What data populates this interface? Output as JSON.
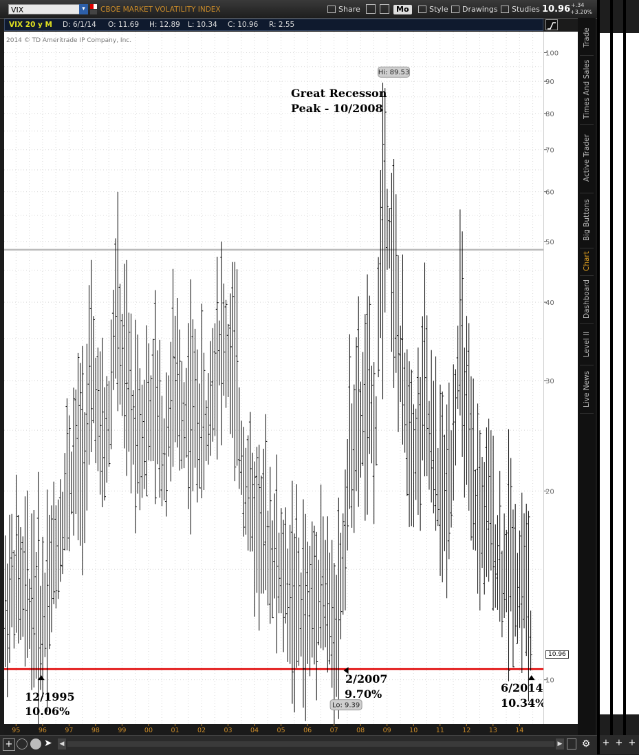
{
  "toolbar": {
    "symbol": "VIX",
    "description": "CBOE MARKET VOLATILITY INDEX",
    "share": "Share",
    "mode": "Mo",
    "style": "Style",
    "drawings": "Drawings",
    "studies": "Studies",
    "last_price": "10.96",
    "change": "+.34",
    "change_pct": "+3.20%"
  },
  "infobar": {
    "period": "VIX 20 y M",
    "date": "D: 6/1/14",
    "open": "O: 11.69",
    "high": "H: 12.89",
    "low": "L: 10.34",
    "close": "C: 10.96",
    "range": "R: 2.55"
  },
  "copyright": "2014 © TD Ameritrade IP Company, Inc.",
  "right_tabs": [
    "Trade",
    "Times And Sales",
    "Active Trader",
    "Big Buttons",
    "Chart",
    "Dashboard",
    "Level II",
    "Live News"
  ],
  "annotations": {
    "peak_line1": "Great Recesson",
    "peak_line2": "Peak - 10/2008",
    "low1_date": "12/1995",
    "low1_value": "10.06%",
    "low2_date": "2/2007",
    "low2_value": "9.70%",
    "low3_date": "6/2014",
    "low3_value": "10.34%"
  },
  "colors": {
    "support_line": "#e00000",
    "resistance_line": "#bbbbbb",
    "bars": "#000000",
    "accent": "#c98b2a"
  },
  "chart_data": {
    "type": "ohlc",
    "scale": "log",
    "ylim": [
      8.5,
      108
    ],
    "y_ticks": [
      10,
      20,
      30,
      40,
      50,
      60,
      70,
      80,
      90,
      100
    ],
    "x_tick_labels": [
      "95",
      "96",
      "97",
      "98",
      "99",
      "00",
      "01",
      "02",
      "03",
      "04",
      "05",
      "06",
      "07",
      "08",
      "09",
      "10",
      "11",
      "12",
      "13",
      "14"
    ],
    "x_range": [
      1994.55,
      2014.9
    ],
    "hi_label": "Hi: 89.53",
    "lo_label": "Lo: 9.39",
    "last_label": "10.96",
    "horizontal_lines": [
      {
        "name": "resistance",
        "value": 48.5
      },
      {
        "name": "support",
        "value": 10.4
      }
    ],
    "keypoints": [
      [
        1994.6,
        12
      ],
      [
        1994.9,
        14
      ],
      [
        1995.3,
        13
      ],
      [
        1995.7,
        12.5
      ],
      [
        1995.95,
        11.5
      ],
      [
        1996.3,
        14
      ],
      [
        1996.6,
        16
      ],
      [
        1996.9,
        19
      ],
      [
        1997.2,
        21
      ],
      [
        1997.6,
        22
      ],
      [
        1997.9,
        30
      ],
      [
        1998.2,
        22
      ],
      [
        1998.5,
        24
      ],
      [
        1998.75,
        38
      ],
      [
        1999.0,
        30
      ],
      [
        1999.4,
        25
      ],
      [
        1999.8,
        24
      ],
      [
        2000.2,
        26
      ],
      [
        2000.6,
        22
      ],
      [
        2000.9,
        28
      ],
      [
        2001.2,
        26
      ],
      [
        2001.7,
        25
      ],
      [
        2002.2,
        24
      ],
      [
        2002.6,
        33
      ],
      [
        2002.9,
        32
      ],
      [
        2003.2,
        30
      ],
      [
        2003.5,
        22
      ],
      [
        2004.0,
        17
      ],
      [
        2004.5,
        16
      ],
      [
        2005.0,
        14
      ],
      [
        2005.5,
        12.5
      ],
      [
        2006.0,
        12
      ],
      [
        2006.5,
        14
      ],
      [
        2006.9,
        11.5
      ],
      [
        2007.1,
        11
      ],
      [
        2007.3,
        14
      ],
      [
        2007.6,
        22
      ],
      [
        2007.9,
        24
      ],
      [
        2008.3,
        26
      ],
      [
        2008.6,
        24
      ],
      [
        2008.8,
        60
      ],
      [
        2008.95,
        57
      ],
      [
        2009.2,
        45
      ],
      [
        2009.5,
        30
      ],
      [
        2009.8,
        24
      ],
      [
        2010.2,
        22
      ],
      [
        2010.4,
        28
      ],
      [
        2010.6,
        23
      ],
      [
        2010.9,
        20
      ],
      [
        2011.2,
        18
      ],
      [
        2011.5,
        23
      ],
      [
        2011.75,
        34
      ],
      [
        2011.95,
        26
      ],
      [
        2012.2,
        19
      ],
      [
        2012.6,
        17
      ],
      [
        2012.95,
        17
      ],
      [
        2013.3,
        14
      ],
      [
        2013.7,
        15
      ],
      [
        2013.95,
        13.5
      ],
      [
        2014.2,
        14
      ],
      [
        2014.45,
        11
      ]
    ]
  }
}
